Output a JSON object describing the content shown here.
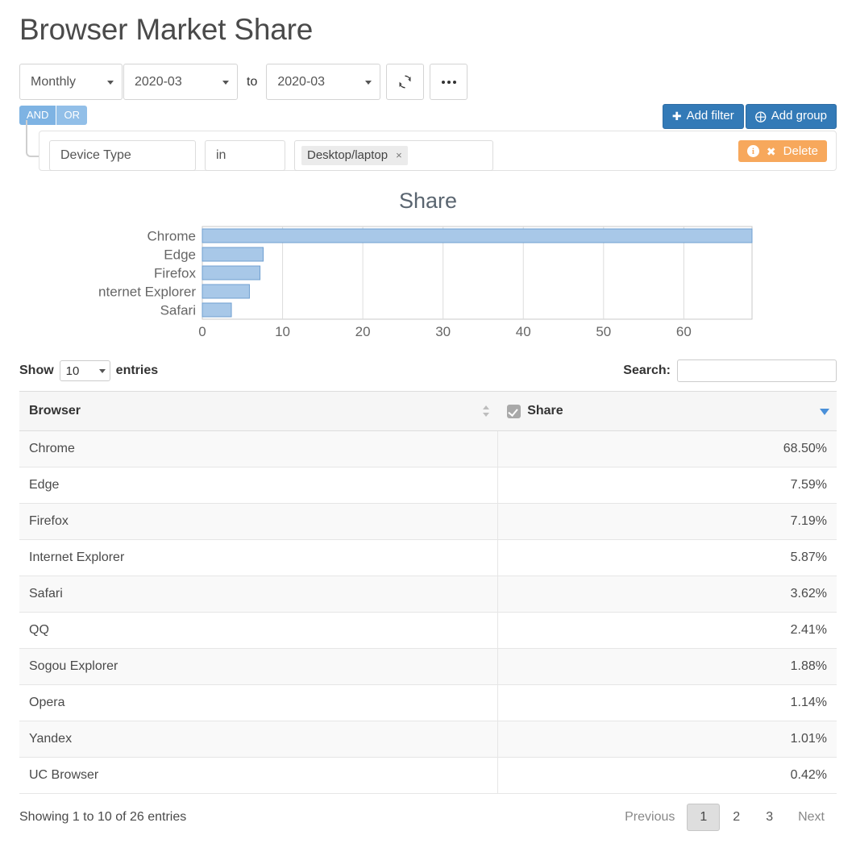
{
  "header": {
    "title": "Browser Market Share"
  },
  "toolbar": {
    "period": "Monthly",
    "date_from": "2020-03",
    "to_label": "to",
    "date_to": "2020-03",
    "refresh_icon": "refresh-icon",
    "more_icon": "ellipsis-icon"
  },
  "filters": {
    "and_label": "AND",
    "or_label": "OR",
    "add_filter_label": "Add filter",
    "add_filter_icon": "plus-icon",
    "add_group_label": "Add group",
    "add_group_icon": "plus-circle-icon",
    "rule": {
      "field": "Device Type",
      "operator": "in",
      "value_tag": "Desktop/laptop",
      "value_tag_remove": "×"
    },
    "delete_label": "Delete",
    "delete_info_icon": "info-icon",
    "delete_x_icon": "close-icon"
  },
  "chart_data": {
    "type": "bar",
    "orientation": "horizontal",
    "title": "Share",
    "categories": [
      "Chrome",
      "Edge",
      "Firefox",
      "Internet Explorer",
      "Safari"
    ],
    "values": [
      68.5,
      7.59,
      7.19,
      5.87,
      3.62
    ],
    "xlabel": "",
    "ylabel": "",
    "xlim": [
      0,
      68.5
    ],
    "xticks": [
      0,
      10,
      20,
      30,
      40,
      50,
      60
    ],
    "grid": true,
    "legend": false,
    "bar_fill": "#a8c8e8",
    "bar_stroke": "#6f9fd0"
  },
  "table": {
    "length_label_before": "Show",
    "length_value": "10",
    "length_label_after": "entries",
    "search_label": "Search:",
    "search_value": "",
    "search_placeholder": "",
    "columns": [
      {
        "label": "Browser",
        "sort": "sortable"
      },
      {
        "label": "Share",
        "sort": "desc",
        "checkbox": true
      }
    ],
    "rows": [
      {
        "browser": "Chrome",
        "share": "68.50%"
      },
      {
        "browser": "Edge",
        "share": "7.59%"
      },
      {
        "browser": "Firefox",
        "share": "7.19%"
      },
      {
        "browser": "Internet Explorer",
        "share": "5.87%"
      },
      {
        "browser": "Safari",
        "share": "3.62%"
      },
      {
        "browser": "QQ",
        "share": "2.41%"
      },
      {
        "browser": "Sogou Explorer",
        "share": "1.88%"
      },
      {
        "browser": "Opera",
        "share": "1.14%"
      },
      {
        "browser": "Yandex",
        "share": "1.01%"
      },
      {
        "browser": "UC Browser",
        "share": "0.42%"
      }
    ],
    "info": "Showing 1 to 10 of 26 entries",
    "paging": {
      "previous": "Previous",
      "pages": [
        "1",
        "2",
        "3"
      ],
      "active_page": "1",
      "next": "Next"
    }
  },
  "colors": {
    "accent_blue": "#337ab7",
    "andor_blue": "#7eb3e3",
    "orange": "#f7a85c",
    "sort_blue": "#4a90d9",
    "bar_fill": "#a8c8e8"
  }
}
